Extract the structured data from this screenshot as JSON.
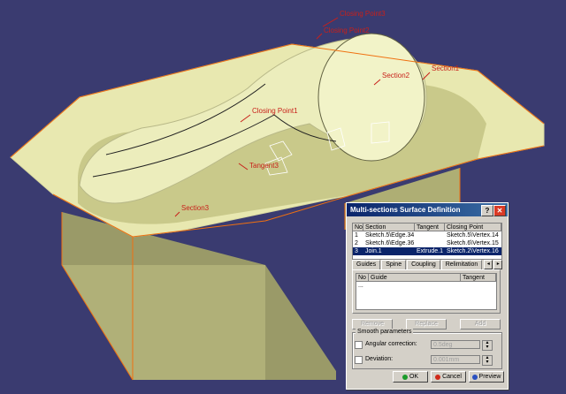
{
  "viewport": {
    "labels": {
      "closing_point_a": "Closing Point3",
      "closing_point_b": "Closing Point2",
      "section2": "Section2",
      "section1": "Section1",
      "closing_point_c": "Closing Point1",
      "tangent": "Tangent3",
      "section3": "Section3"
    }
  },
  "dialog": {
    "title": "Multi-sections Surface Definition",
    "help_icon": "?",
    "close_icon": "✕",
    "sections_table": {
      "headers": [
        "No",
        "Section",
        "Tangent",
        "Closing Point"
      ],
      "rows": [
        [
          "1",
          "Sketch.5\\Edge.34",
          "",
          "Sketch.5\\Vertex.14"
        ],
        [
          "2",
          "Sketch.6\\Edge.36",
          "",
          "Sketch.6\\Vertex.15"
        ],
        [
          "3",
          "Join.1",
          "Extrude.1",
          "Sketch.2\\Vertex.16"
        ]
      ],
      "selected_row": 2
    },
    "tabs": [
      "Guides",
      "Spine",
      "Coupling",
      "Relimitation"
    ],
    "active_tab": "Guides",
    "guides_table": {
      "headers": [
        "No",
        "Guide",
        "Tangent"
      ],
      "rows": [
        [
          "...",
          "",
          ""
        ]
      ]
    },
    "action_buttons": [
      "Remove",
      "Replace",
      "Add"
    ],
    "smooth": {
      "title": "Smooth parameters",
      "angular_label": "Angular correction:",
      "angular_value": "0.5deg",
      "deviation_label": "Deviation:",
      "deviation_value": "0.001mm"
    },
    "buttons": {
      "ok": "OK",
      "cancel": "Cancel",
      "preview": "Preview"
    }
  },
  "colors": {
    "background": "#3a3b70",
    "surface": "#e8e8b0",
    "edge": "#f07010",
    "label": "#c8201a",
    "titlebar": "#0a246a"
  }
}
